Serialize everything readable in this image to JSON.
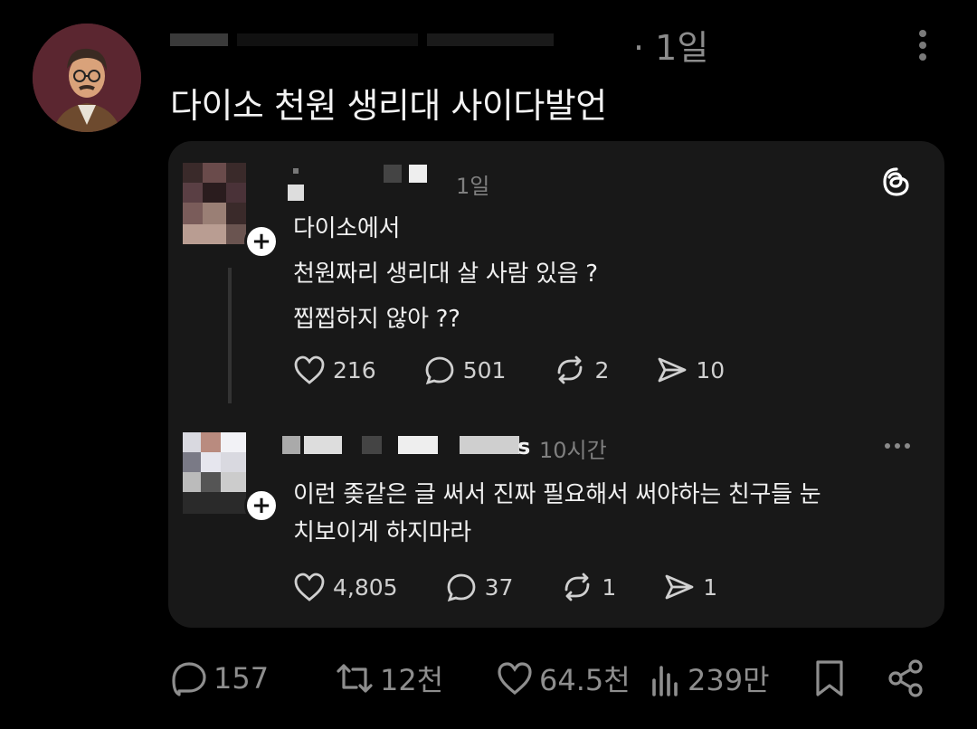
{
  "tweet": {
    "time": "· 1일",
    "text": "다이소 천원 생리대 사이다발언"
  },
  "card": {
    "post1": {
      "time": "1일",
      "lines": [
        "다이소에서",
        "천원짜리 생리대 살 사람 있음 ?",
        "찝찝하지 않아 ??"
      ],
      "likes": "216",
      "replies": "501",
      "reposts": "2",
      "shares": "10"
    },
    "post2": {
      "username_tail": "s",
      "time": "10시간",
      "lines": [
        "이런 좆같은 글 써서 진짜 필요해서 써야하는 친구들 눈",
        "치보이게 하지마라"
      ],
      "likes": "4,805",
      "replies": "37",
      "reposts": "1",
      "shares": "1"
    }
  },
  "stats": {
    "replies": "157",
    "retweets": "12천",
    "likes": "64.5천",
    "views": "239만"
  },
  "colors": {
    "background": "#000000",
    "card": "#181818",
    "muted": "#8e8e8e",
    "avatar_bg": "#5b2630"
  },
  "icons": [
    "more-vertical-icon",
    "threads-logo-icon",
    "heart-icon",
    "comment-icon",
    "repost-icon",
    "send-icon",
    "retweet-icon",
    "views-icon",
    "bookmark-icon",
    "share-icon",
    "plus-icon",
    "more-horizontal-icon"
  ]
}
